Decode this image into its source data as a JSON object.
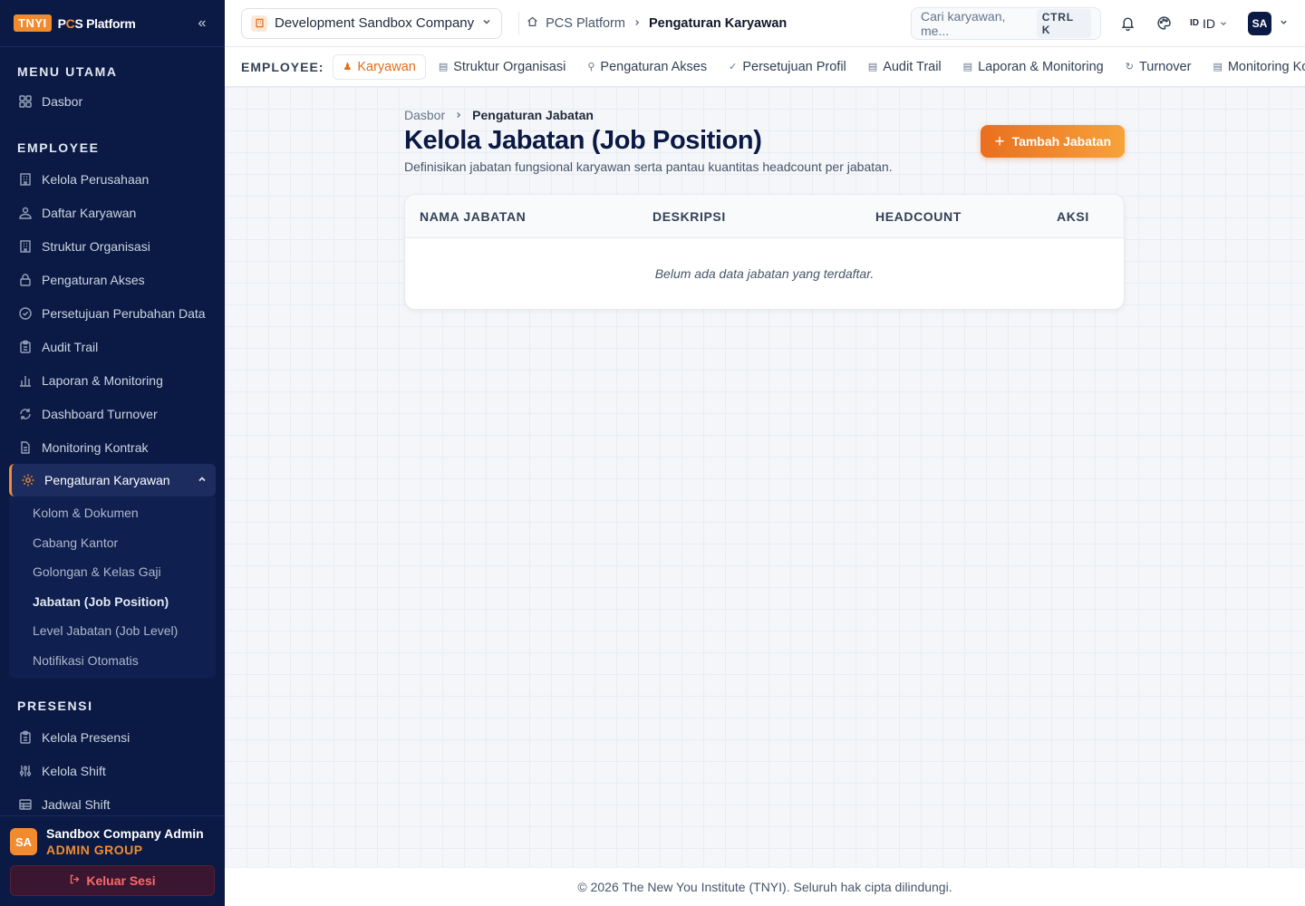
{
  "brand": {
    "badge": "TNYI",
    "name_pre": "P",
    "name_accent": "C",
    "name_post": "S Platform"
  },
  "sidebar": {
    "collapse_glyph": "«",
    "sections": {
      "main_title": "MENU UTAMA",
      "employee_title": "EMPLOYEE",
      "presensi_title": "PRESENSI"
    },
    "main_items": [
      {
        "label": "Dasbor",
        "icon": "grid-icon"
      }
    ],
    "employee_items": [
      {
        "label": "Kelola Perusahaan",
        "icon": "building-icon"
      },
      {
        "label": "Daftar Karyawan",
        "icon": "users-icon"
      },
      {
        "label": "Struktur Organisasi",
        "icon": "org-icon"
      },
      {
        "label": "Pengaturan Akses",
        "icon": "lock-icon"
      },
      {
        "label": "Persetujuan Perubahan Data",
        "icon": "check-circle-icon"
      },
      {
        "label": "Audit Trail",
        "icon": "clipboard-icon"
      },
      {
        "label": "Laporan & Monitoring",
        "icon": "bar-chart-icon"
      },
      {
        "label": "Dashboard Turnover",
        "icon": "refresh-icon"
      },
      {
        "label": "Monitoring Kontrak",
        "icon": "document-icon"
      }
    ],
    "active_item": {
      "label": "Pengaturan Karyawan",
      "icon": "gear-icon"
    },
    "sub_items": [
      "Kolom & Dokumen",
      "Cabang Kantor",
      "Golongan & Kelas Gaji",
      "Jabatan (Job Position)",
      "Level Jabatan (Job Level)",
      "Notifikasi Otomatis"
    ],
    "presensi_items": [
      {
        "label": "Kelola Presensi",
        "icon": "clipboard-icon"
      },
      {
        "label": "Kelola Shift",
        "icon": "sliders-icon"
      },
      {
        "label": "Jadwal Shift",
        "icon": "table-icon"
      }
    ],
    "user": {
      "initials": "SA",
      "name": "Sandbox Company Admin",
      "group": "ADMIN GROUP"
    },
    "logout_label": "Keluar Sesi"
  },
  "topbar": {
    "company": "Development Sandbox Company",
    "breadcrumb": [
      "PCS Platform",
      "Pengaturan Karyawan"
    ],
    "search_placeholder": "Cari karyawan, me...",
    "search_shortcut": "CTRL K",
    "lang_flag": "ID",
    "lang": "ID",
    "avatar": "SA"
  },
  "subnav": {
    "label": "EMPLOYEE:",
    "items": [
      "Karyawan",
      "Struktur Organisasi",
      "Pengaturan Akses",
      "Persetujuan Profil",
      "Audit Trail",
      "Laporan & Monitoring",
      "Turnover",
      "Monitoring Ko"
    ]
  },
  "page": {
    "breadcrumb": [
      "Dasbor",
      "Pengaturan Jabatan"
    ],
    "title": "Kelola Jabatan (Job Position)",
    "description": "Definisikan jabatan fungsional karyawan serta pantau kuantitas headcount per jabatan.",
    "add_button": "Tambah Jabatan",
    "table": {
      "columns": [
        "NAMA JABATAN",
        "DESKRIPSI",
        "HEADCOUNT",
        "AKSI"
      ],
      "empty_text": "Belum ada data jabatan yang terdaftar."
    }
  },
  "footer": "© 2026 The New You Institute (TNYI). Seluruh hak cipta dilindungi.",
  "colors": {
    "accent": "#f28b30",
    "sidebar_bg": "#0b1a45",
    "logout": "#fb6a6a"
  }
}
